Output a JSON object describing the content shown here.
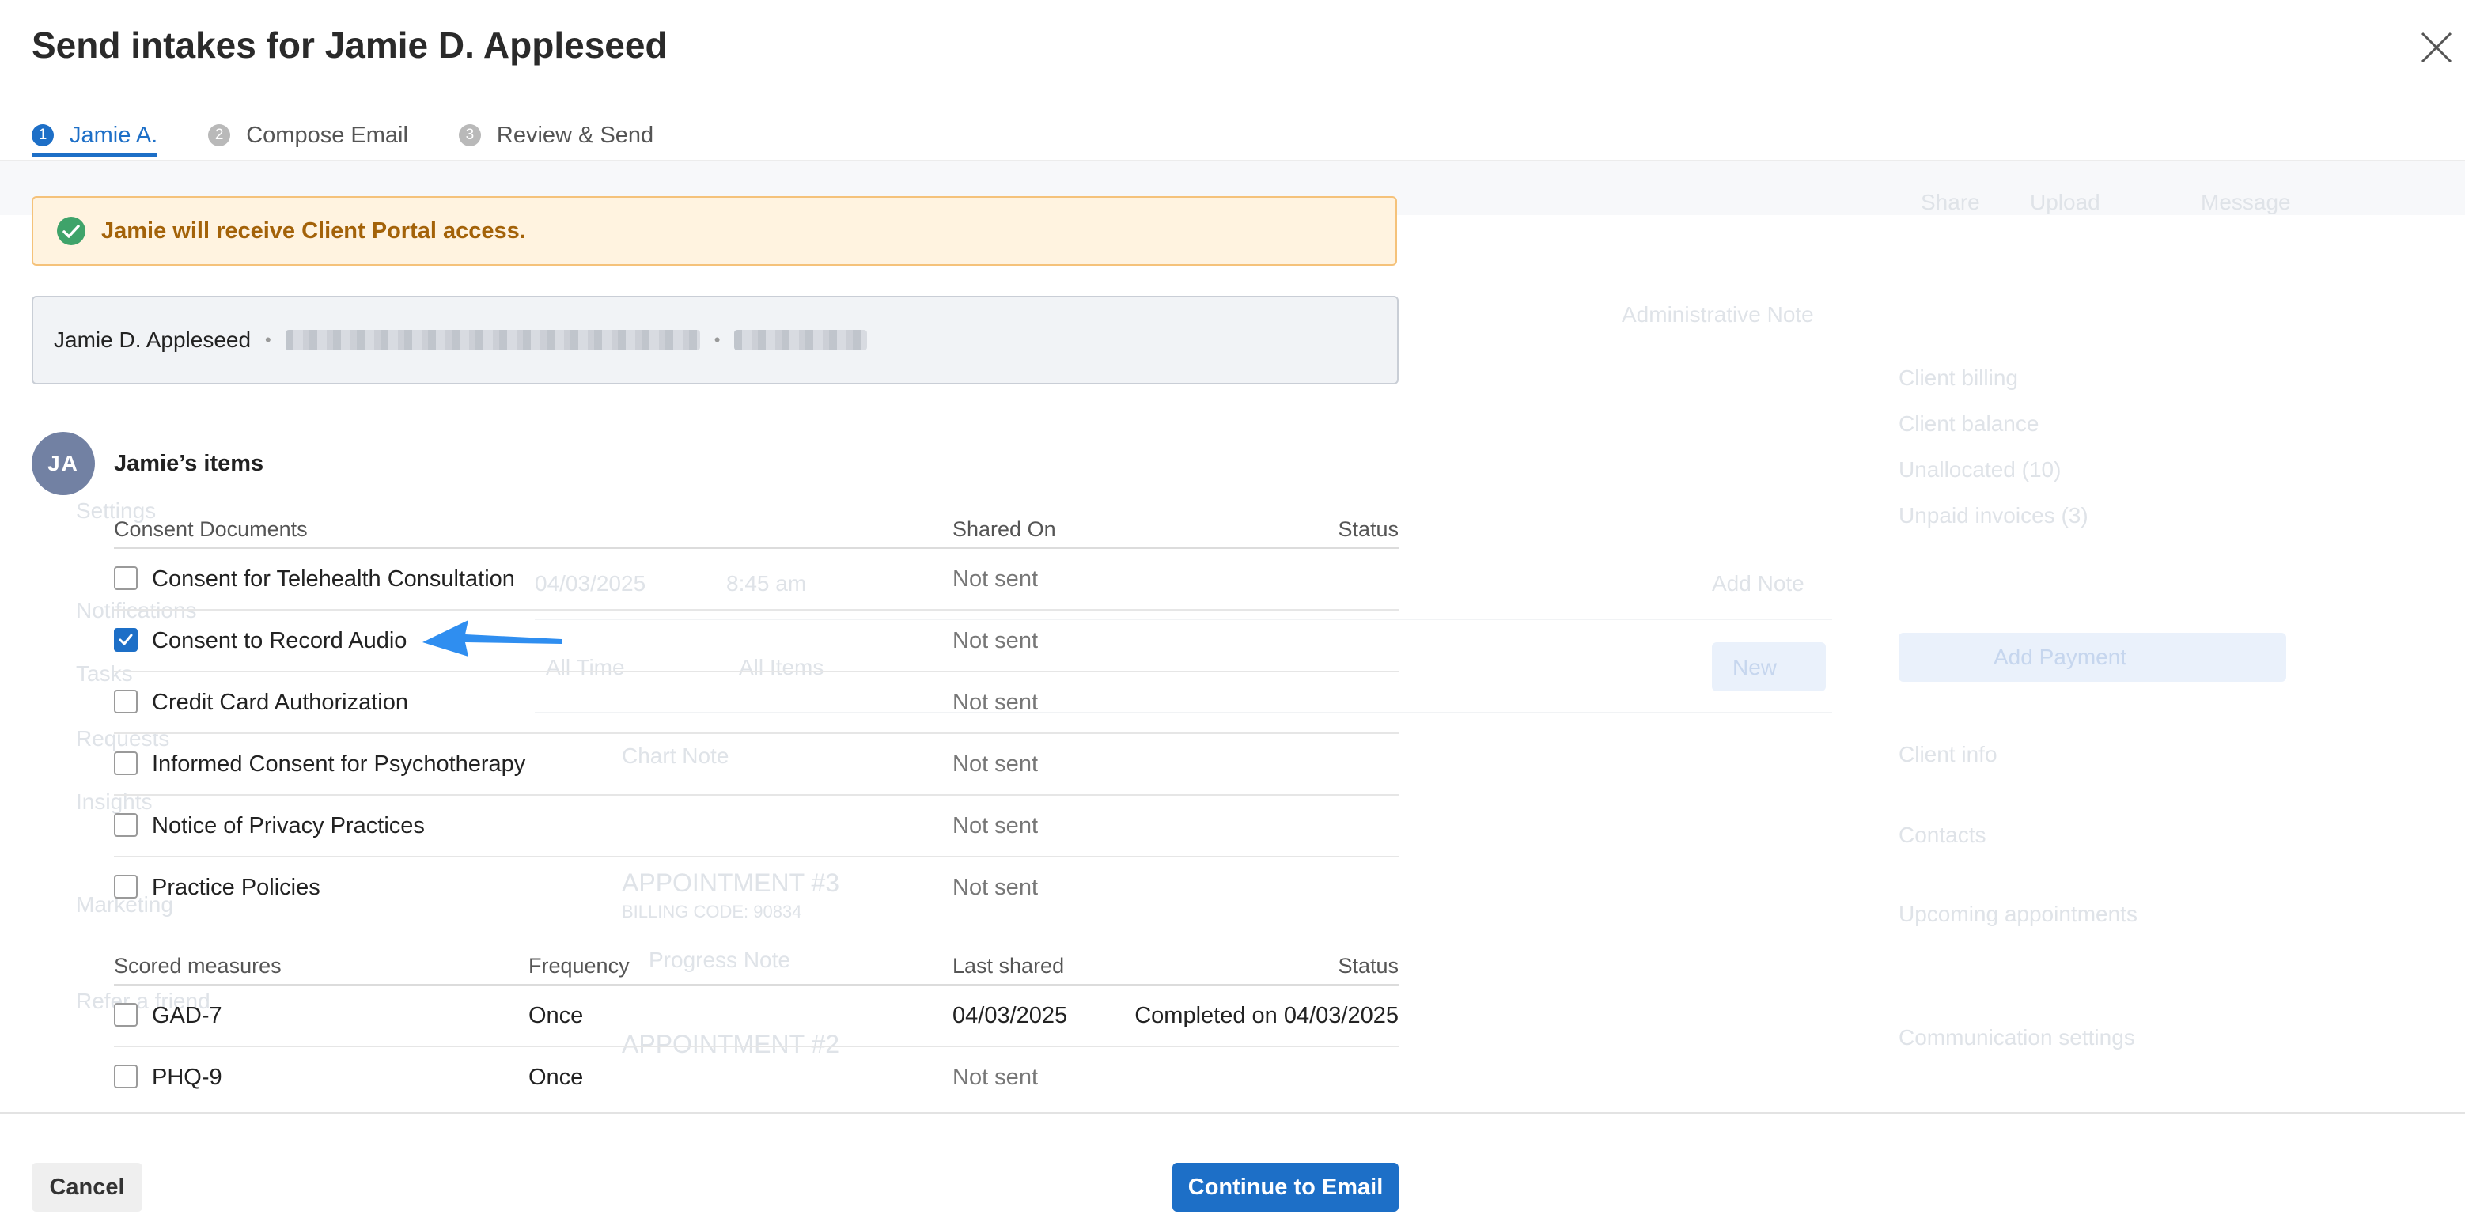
{
  "modal": {
    "title": "Send intakes for Jamie D. Appleseed",
    "close_icon": "close-icon"
  },
  "steps": [
    {
      "number": "1",
      "label": "Jamie A.",
      "active": true
    },
    {
      "number": "2",
      "label": "Compose Email",
      "active": false
    },
    {
      "number": "3",
      "label": "Review & Send",
      "active": false
    }
  ],
  "alert": {
    "text": "Jamie will receive Client Portal access.",
    "icon": "check-circle-icon",
    "color": "#a36209"
  },
  "client": {
    "name": "Jamie D. Appleseed"
  },
  "items": {
    "avatar_initials": "JA",
    "title": "Jamie’s items"
  },
  "consent_documents": {
    "headers": {
      "name": "Consent Documents",
      "shared_on": "Shared On",
      "status": "Status"
    },
    "rows": [
      {
        "label": "Consent for Telehealth Consultation",
        "shared_on": "Not sent",
        "status": "",
        "checked": false
      },
      {
        "label": "Consent to Record Audio",
        "shared_on": "Not sent",
        "status": "",
        "checked": true
      },
      {
        "label": "Credit Card Authorization",
        "shared_on": "Not sent",
        "status": "",
        "checked": false
      },
      {
        "label": "Informed Consent for Psychotherapy",
        "shared_on": "Not sent",
        "status": "",
        "checked": false
      },
      {
        "label": "Notice of Privacy Practices",
        "shared_on": "Not sent",
        "status": "",
        "checked": false
      },
      {
        "label": "Practice Policies",
        "shared_on": "Not sent",
        "status": "",
        "checked": false
      }
    ]
  },
  "scored_measures": {
    "headers": {
      "name": "Scored measures",
      "frequency": "Frequency",
      "last_shared": "Last shared",
      "status": "Status"
    },
    "rows": [
      {
        "label": "GAD-7",
        "frequency": "Once",
        "last_shared": "04/03/2025",
        "status": "Completed on 04/03/2025",
        "checked": false
      },
      {
        "label": "PHQ-9",
        "frequency": "Once",
        "last_shared": "Not sent",
        "status": "",
        "checked": false
      }
    ]
  },
  "footer": {
    "cancel_label": "Cancel",
    "continue_label": "Continue to Email"
  },
  "background": {
    "items": [
      "Share",
      "Upload",
      "Message",
      "Administrative Note",
      "Client billing",
      "Client balance",
      "Unallocated (10)",
      "Unpaid invoices (3)",
      "Add Payment",
      "Client info",
      "Contacts",
      "Upcoming appointments",
      "Communication settings",
      "04/03/2025",
      "8:45 am",
      "All Time",
      "All Items",
      "New",
      "Chart Note",
      "APPOINTMENT #3",
      "BILLING CODE: 90834",
      "Progress Note",
      "APPOINTMENT #2",
      "Add Note",
      "Settings",
      "Notifications",
      "Tasks",
      "Requests",
      "Insights",
      "Marketing",
      "Refer a friend"
    ],
    "accent": "#1d6fc7"
  }
}
